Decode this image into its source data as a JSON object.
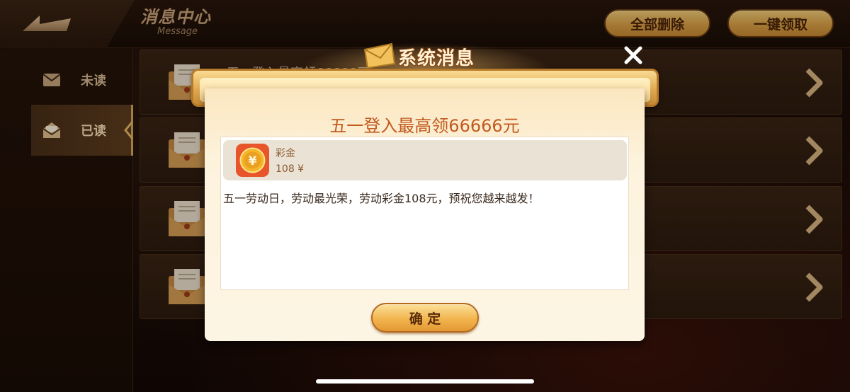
{
  "header": {
    "title": "消息中心",
    "subtitle": "Message",
    "delete_all_label": "全部删除",
    "claim_all_label": "一键领取"
  },
  "sidebar": {
    "items": [
      {
        "label": "未读",
        "icon": "envelope-closed-icon"
      },
      {
        "label": "已读",
        "icon": "envelope-open-icon",
        "active": true
      }
    ]
  },
  "messages": [
    {
      "title": "五一登入最高领66666元"
    },
    {
      "title": ""
    },
    {
      "title": ""
    },
    {
      "title": ""
    }
  ],
  "modal": {
    "header_title": "系统消息",
    "message_title": "五一登入最高领66666元",
    "reward": {
      "name": "彩金",
      "amount": "108 ¥",
      "icon": "yuan-coin-icon"
    },
    "body": "五一劳动日，劳动最光荣，劳动彩金108元，预祝您越来越发！",
    "confirm_label": "确 定"
  },
  "colors": {
    "gold_button": "#dda247",
    "accent_title": "#c25a1e",
    "background": "#1a0d06"
  }
}
